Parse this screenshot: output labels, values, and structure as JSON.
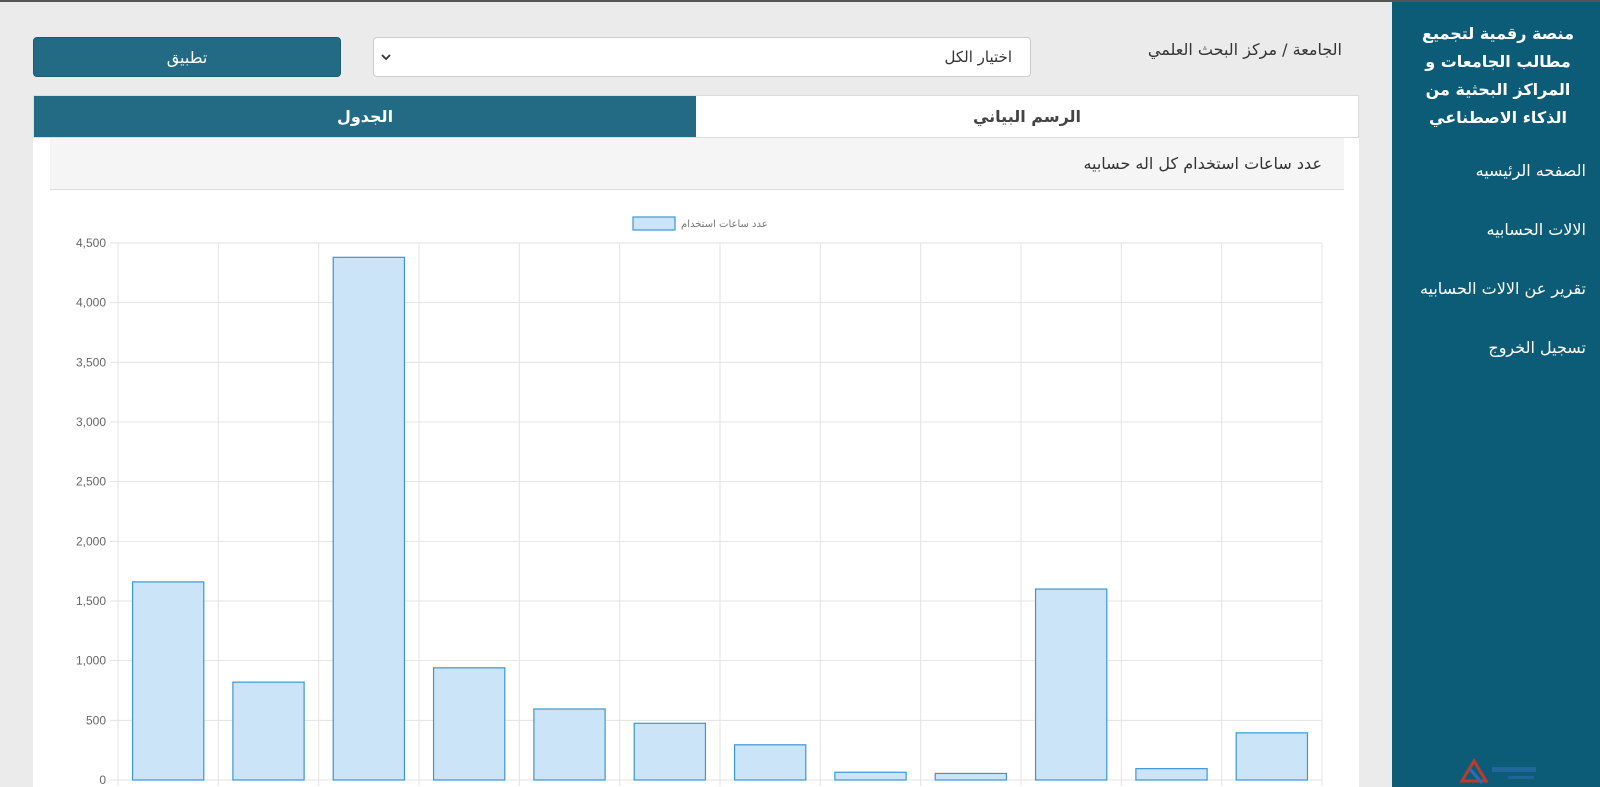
{
  "sidebar": {
    "brand": "منصة رقمية لتجميع مطالب الجامعات و المراكز البحثية من الذكاء الاصطناعي",
    "items": [
      {
        "label": "الصفحه الرئيسيه"
      },
      {
        "label": "الالات الحسابيه"
      },
      {
        "label": "تقرير عن الالات الحسابيه"
      },
      {
        "label": "تسجيل الخروج"
      }
    ]
  },
  "filter": {
    "label": "الجامعة / مركز البحث العلمي",
    "selected": "اختيار الكل",
    "apply_label": "تطبيق"
  },
  "tabs": [
    {
      "label": "الرسم البياني",
      "active": false
    },
    {
      "label": "الجدول",
      "active": true
    }
  ],
  "panel": {
    "title": "عدد ساعات استخدام كل اله حسابيه"
  },
  "colors": {
    "sidebar": "#0d5c77",
    "accent": "#236b85",
    "bar_fill": "#cce4f8",
    "bar_stroke": "#3b96d6"
  },
  "chart_data": {
    "type": "bar",
    "legend": "عدد ساعات استخدام",
    "legend_position": "top",
    "ylim": [
      0,
      4500
    ],
    "yticks": [
      0,
      500,
      1000,
      1500,
      2000,
      2500,
      3000,
      3500,
      4000,
      4500
    ],
    "ytick_labels": [
      "0",
      "500",
      "1,000",
      "1,500",
      "2,000",
      "2,500",
      "3,000",
      "3,500",
      "4,000",
      "4,500"
    ],
    "grid": true,
    "series": [
      {
        "name": "عدد ساعات استخدام",
        "values": [
          1660,
          820,
          4380,
          940,
          595,
          475,
          295,
          65,
          55,
          1600,
          95,
          395
        ]
      }
    ]
  }
}
